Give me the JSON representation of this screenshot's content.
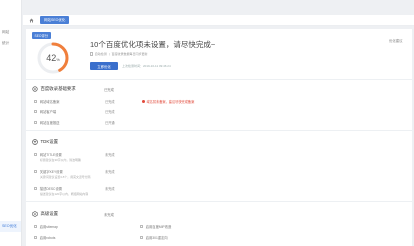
{
  "sidebar": {
    "items": [
      {
        "label": "网站"
      },
      {
        "label": "统计"
      },
      {
        "label": "SEO优化"
      }
    ]
  },
  "topbar": {
    "tab": "网站SEO优化"
  },
  "overview": {
    "badge": "SEO评分",
    "score": "42",
    "score_unit": "%",
    "score_fraction": 0.42,
    "headline": "10个百度优化项未设置，请尽快完成~",
    "right_link": "优化建议",
    "note_a": "自动检测",
    "note_b": "百度收录数据每日同步更新",
    "optimize_label": "立即优化",
    "last_check": "上次检测时间：2019-10-11 09:46:24"
  },
  "sections": [
    {
      "title": "百度收录基础要求",
      "status": "已完成",
      "rows": [
        {
          "label": "网站域名备案",
          "status": "已完成",
          "status_red": false,
          "warn": "域名暂未备案，建议尽快完成备案"
        },
        {
          "label": "网站客户端",
          "status": "已完成",
          "status_red": false
        },
        {
          "label": "网站百度推送",
          "status": "已开通",
          "status_red": false
        }
      ]
    },
    {
      "title": "TDK设置",
      "status": "未完成",
      "rows": [
        {
          "label": "网站TITLE设置",
          "status": "未完成",
          "desc": "标题建议在30字以内，简洁明确"
        },
        {
          "label": "关键字KEY设置",
          "status": "未完成",
          "desc": "关键词建议设置3-5个，用英文逗号分隔"
        },
        {
          "label": "描述DESC设置",
          "status": "未完成",
          "desc": "描述建议在120字以内，概括网站内容"
        }
      ]
    },
    {
      "title": "高级设置",
      "status": "未完成",
      "left": [
        {
          "label": "启用sitemap"
        },
        {
          "label": "启用robots"
        }
      ],
      "right": [
        {
          "label": "启用百度MIP改造"
        },
        {
          "label": "启用301重定向"
        }
      ]
    }
  ],
  "colors": {
    "accent": "#4a7fd6",
    "gauge": "#f07f3c",
    "warn": "#e14a3b"
  }
}
